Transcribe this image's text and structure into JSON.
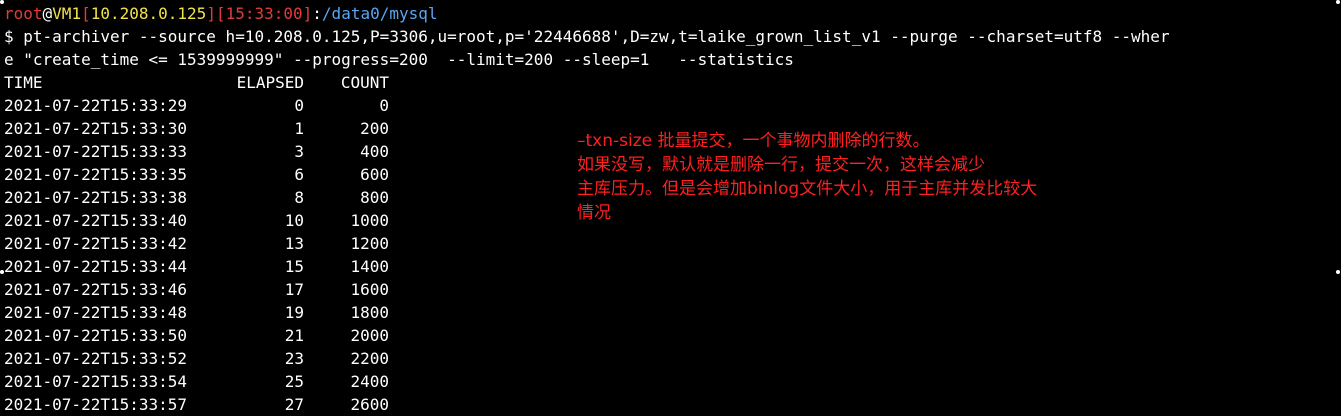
{
  "prompt": {
    "user": "root",
    "at": "@",
    "host": "VM1",
    "ip": "10.208.0.125",
    "time": "15:33:00",
    "colon": ":",
    "path": "/data0/mysql"
  },
  "command_lines": [
    "$ pt-archiver --source h=10.208.0.125,P=3306,u=root,p='22446688',D=zw,t=laike_grown_list_v1 --purge --charset=utf8 --wher",
    "e \"create_time <= 1539999999\" --progress=200  --limit=200 --sleep=1   --statistics"
  ],
  "table": {
    "headers": [
      "TIME",
      "ELAPSED",
      "COUNT"
    ],
    "rows": [
      {
        "time": "2021-07-22T15:33:29",
        "elapsed": "0",
        "count": "0"
      },
      {
        "time": "2021-07-22T15:33:30",
        "elapsed": "1",
        "count": "200"
      },
      {
        "time": "2021-07-22T15:33:33",
        "elapsed": "3",
        "count": "400"
      },
      {
        "time": "2021-07-22T15:33:35",
        "elapsed": "6",
        "count": "600"
      },
      {
        "time": "2021-07-22T15:33:38",
        "elapsed": "8",
        "count": "800"
      },
      {
        "time": "2021-07-22T15:33:40",
        "elapsed": "10",
        "count": "1000"
      },
      {
        "time": "2021-07-22T15:33:42",
        "elapsed": "13",
        "count": "1200"
      },
      {
        "time": "2021-07-22T15:33:44",
        "elapsed": "15",
        "count": "1400"
      },
      {
        "time": "2021-07-22T15:33:46",
        "elapsed": "17",
        "count": "1600"
      },
      {
        "time": "2021-07-22T15:33:48",
        "elapsed": "19",
        "count": "1800"
      },
      {
        "time": "2021-07-22T15:33:50",
        "elapsed": "21",
        "count": "2000"
      },
      {
        "time": "2021-07-22T15:33:52",
        "elapsed": "23",
        "count": "2200"
      },
      {
        "time": "2021-07-22T15:33:54",
        "elapsed": "25",
        "count": "2400"
      },
      {
        "time": "2021-07-22T15:33:57",
        "elapsed": "27",
        "count": "2600"
      }
    ]
  },
  "annotation": {
    "lines": [
      "–txn-size 批量提交，一个事物内删除的行数。",
      "如果没写，默认就是删除一行，提交一次，这样会减少",
      "主库压力。但是会增加binlog文件大小，用于主库并发比较大",
      "情况"
    ]
  },
  "colors": {
    "background": "#000000",
    "prompt_user": "#e03c3c",
    "prompt_host": "#f2e34a",
    "prompt_path": "#58a6f0",
    "annotation": "#ff2020",
    "text": "#ffffff"
  }
}
